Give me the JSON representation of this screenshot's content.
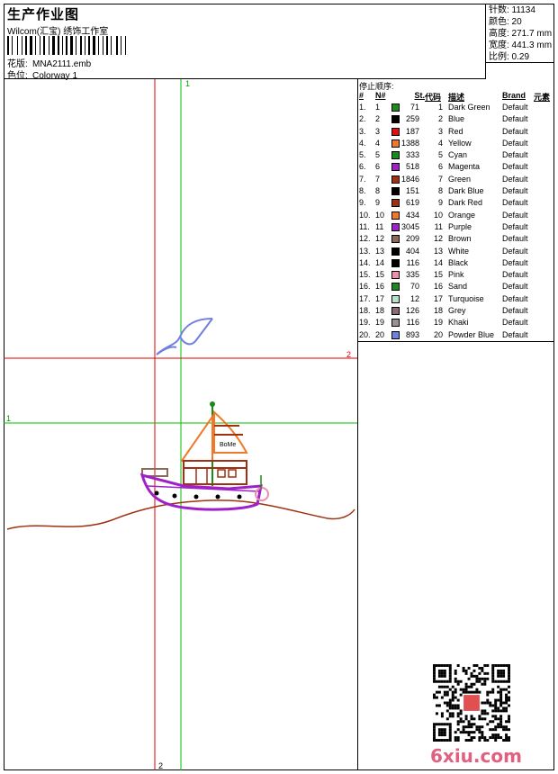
{
  "header": {
    "title": "生产作业图",
    "company": "Wilcom(汇宝) 绣饰工作室",
    "design_label": "花版:",
    "design_value": "MNA2111.emb",
    "colorway_label": "色位:",
    "colorway_value": "Colorway 1"
  },
  "stats": {
    "stitches": "针数: 11134",
    "colors": "颜色: 20",
    "height": "高度: 271.7 mm",
    "width": "宽度: 441.3 mm",
    "scale": "比例: 0.29"
  },
  "canvas": {
    "v_red_label_bottom": "2",
    "v_green_label_top": "1",
    "h_red_label_right": "2",
    "h_green_label_left": "1",
    "sail_text": "BoMe"
  },
  "colors_table": {
    "caption": "停止顺序:",
    "headers": {
      "idx": "#",
      "n": "N#",
      "st": "St.",
      "code": "代码",
      "desc": "描述",
      "brand": "Brand",
      "elem": "元素"
    },
    "rows": [
      {
        "idx": "1.",
        "n": "1",
        "color": "#1a8a1a",
        "st": "71",
        "code": "1",
        "desc": "Dark Green",
        "brand": "Default"
      },
      {
        "idx": "2.",
        "n": "2",
        "color": "#000000",
        "st": "259",
        "code": "2",
        "desc": "Blue",
        "brand": "Default"
      },
      {
        "idx": "3.",
        "n": "3",
        "color": "#e01010",
        "st": "187",
        "code": "3",
        "desc": "Red",
        "brand": "Default"
      },
      {
        "idx": "4.",
        "n": "4",
        "color": "#f07828",
        "st": "1388",
        "code": "4",
        "desc": "Yellow",
        "brand": "Default"
      },
      {
        "idx": "5.",
        "n": "5",
        "color": "#1a8a1a",
        "st": "333",
        "code": "5",
        "desc": "Cyan",
        "brand": "Default"
      },
      {
        "idx": "6.",
        "n": "6",
        "color": "#a020c8",
        "st": "518",
        "code": "6",
        "desc": "Magenta",
        "brand": "Default"
      },
      {
        "idx": "7.",
        "n": "7",
        "color": "#a03010",
        "st": "1846",
        "code": "7",
        "desc": "Green",
        "brand": "Default"
      },
      {
        "idx": "8.",
        "n": "8",
        "color": "#000000",
        "st": "151",
        "code": "8",
        "desc": "Dark Blue",
        "brand": "Default"
      },
      {
        "idx": "9.",
        "n": "9",
        "color": "#a03010",
        "st": "619",
        "code": "9",
        "desc": "Dark Red",
        "brand": "Default"
      },
      {
        "idx": "10.",
        "n": "10",
        "color": "#f07828",
        "st": "434",
        "code": "10",
        "desc": "Orange",
        "brand": "Default"
      },
      {
        "idx": "11.",
        "n": "11",
        "color": "#a020c8",
        "st": "3045",
        "code": "11",
        "desc": "Purple",
        "brand": "Default"
      },
      {
        "idx": "12.",
        "n": "12",
        "color": "#8a6a5a",
        "st": "209",
        "code": "12",
        "desc": "Brown",
        "brand": "Default"
      },
      {
        "idx": "13.",
        "n": "13",
        "color": "#000000",
        "st": "404",
        "code": "13",
        "desc": "White",
        "brand": "Default"
      },
      {
        "idx": "14.",
        "n": "14",
        "color": "#000000",
        "st": "116",
        "code": "14",
        "desc": "Black",
        "brand": "Default"
      },
      {
        "idx": "15.",
        "n": "15",
        "color": "#f08cb0",
        "st": "335",
        "code": "15",
        "desc": "Pink",
        "brand": "Default"
      },
      {
        "idx": "16.",
        "n": "16",
        "color": "#1a8a1a",
        "st": "70",
        "code": "16",
        "desc": "Sand",
        "brand": "Default"
      },
      {
        "idx": "17.",
        "n": "17",
        "color": "#b8e0c8",
        "st": "12",
        "code": "17",
        "desc": "Turquoise",
        "brand": "Default"
      },
      {
        "idx": "18.",
        "n": "18",
        "color": "#8a6a78",
        "st": "126",
        "code": "18",
        "desc": "Grey",
        "brand": "Default"
      },
      {
        "idx": "19.",
        "n": "19",
        "color": "#9a9090",
        "st": "116",
        "code": "19",
        "desc": "Khaki",
        "brand": "Default"
      },
      {
        "idx": "20.",
        "n": "20",
        "color": "#7080e0",
        "st": "893",
        "code": "20",
        "desc": "Powder Blue",
        "brand": "Default"
      }
    ]
  },
  "watermark": "6xiu.com"
}
